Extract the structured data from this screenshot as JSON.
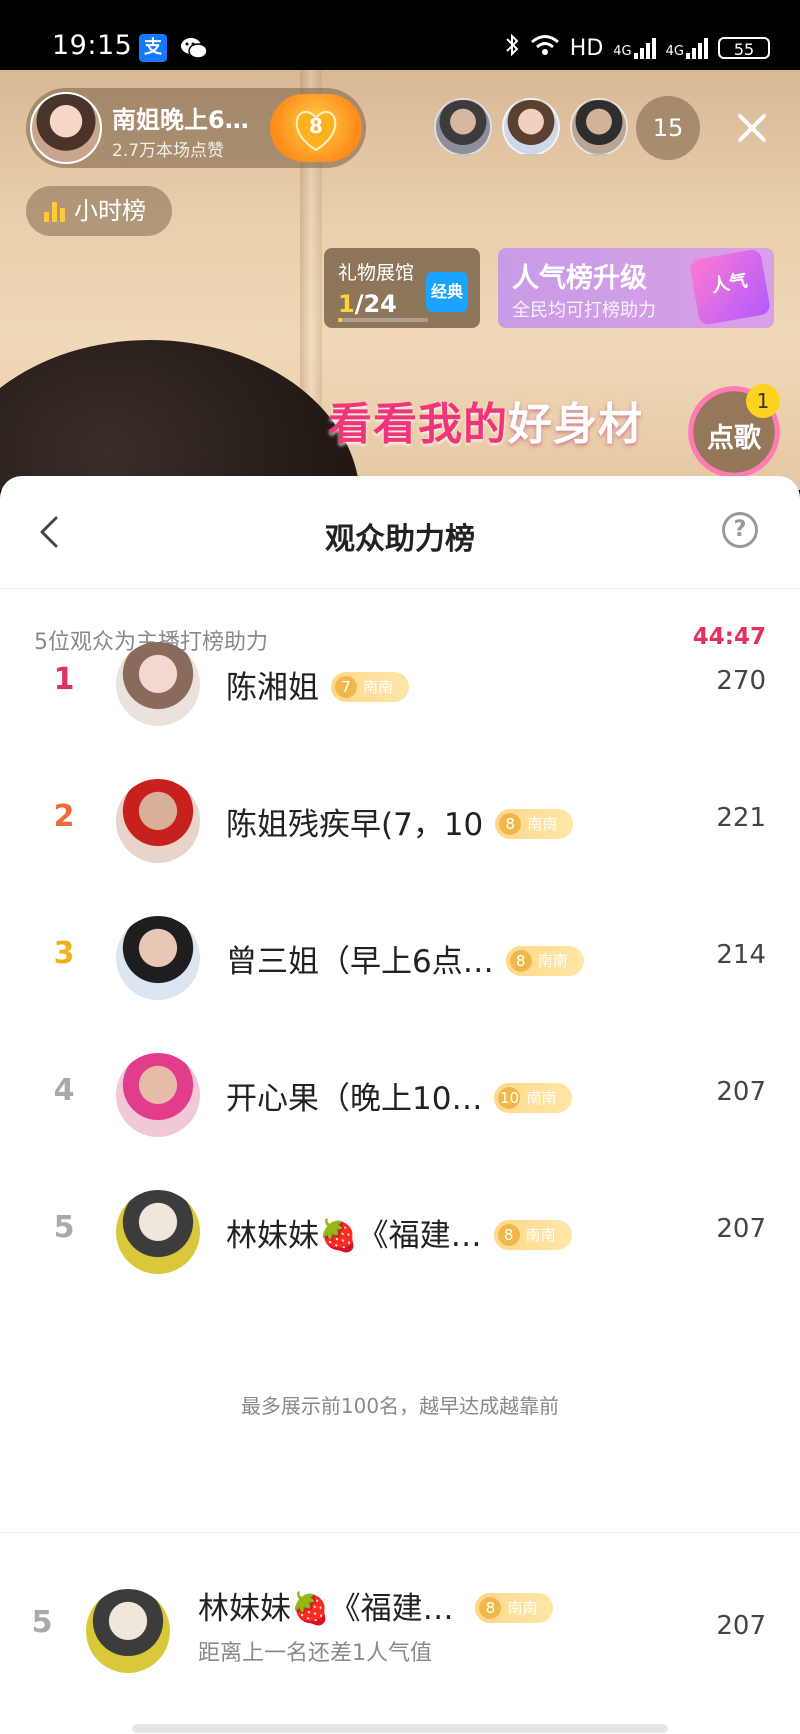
{
  "status_bar": {
    "time": "19:15",
    "alipay_label": "支",
    "network_label": "HD",
    "signal1_label": "4G",
    "signal2_label": "4G",
    "battery": "55"
  },
  "stream": {
    "host_name": "南姐晚上6…",
    "host_likes": "2.7万本场点赞",
    "fan_level": "8",
    "viewer_count": "15",
    "hour_rank_label": "小时榜",
    "gift_hall": {
      "title": "礼物展馆",
      "progress_current": "1",
      "progress_total": "/24",
      "progress_fraction": 0.04,
      "tag": "经典"
    },
    "popularity": {
      "title": "人气榜升级",
      "subtitle": "全民均可打榜助力",
      "badge": "人气"
    },
    "overlay_pink": "看看我的",
    "overlay_white": "好身材",
    "song_button": "点歌",
    "song_count": "1"
  },
  "sheet": {
    "title": "观众助力榜",
    "summary": "5位观众为主播打榜助力",
    "countdown": "44:47",
    "footnote": "最多展示前100名，越早达成越靠前",
    "rows": [
      {
        "rank": "1",
        "rank_color": "#e0325e",
        "name": "陈湘姐",
        "level": "7",
        "club": "南南",
        "score": "270",
        "avatar_colors": [
          "#f3d8cf",
          "#8a6a5a",
          "#e9e2dd"
        ]
      },
      {
        "rank": "2",
        "rank_color": "#f06a3a",
        "name": "陈姐残疾早(7，10",
        "level": "8",
        "club": "南南",
        "score": "221",
        "avatar_colors": [
          "#d8b09a",
          "#c8201c",
          "#e8d4c9"
        ]
      },
      {
        "rank": "3",
        "rank_color": "#f0b020",
        "name": "曾三姐（早上6点…",
        "level": "8",
        "club": "南南",
        "score": "214",
        "avatar_colors": [
          "#e8c8b4",
          "#1e1e1e",
          "#dce6f2"
        ]
      },
      {
        "rank": "4",
        "rank_color": "#aaaaaa",
        "name": "开心果（晚上10…",
        "level": "10",
        "club": "南南",
        "score": "207",
        "avatar_colors": [
          "#e6bca8",
          "#e23c8c",
          "#f0c8d8"
        ]
      },
      {
        "rank": "5",
        "rank_color": "#aaaaaa",
        "name": "林妹妹🍓《福建…",
        "level": "8",
        "club": "南南",
        "score": "207",
        "avatar_colors": [
          "#efe6dc",
          "#3c3c3c",
          "#d8c83a"
        ]
      }
    ],
    "me": {
      "rank": "5",
      "name": "林妹妹🍓《福建…",
      "level": "8",
      "club": "南南",
      "score": "207",
      "subtitle": "距离上一名还差1人气值",
      "avatar_colors": [
        "#efe6dc",
        "#3c3c3c",
        "#d8c83a"
      ]
    }
  }
}
